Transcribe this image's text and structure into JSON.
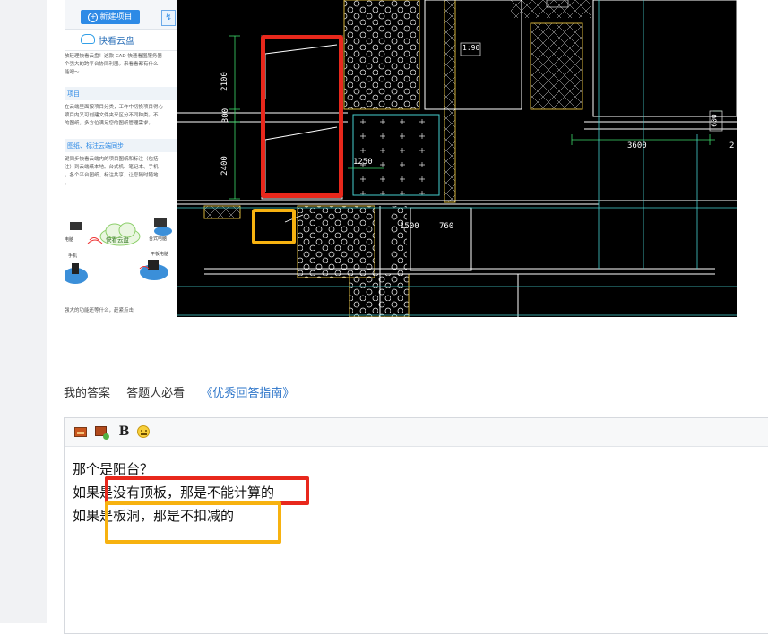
{
  "screenshot_panel": {
    "new_project_label": "新建项目",
    "cloud_title": "快看云盘",
    "intro_text": [
      "放轻理快看云盘！这款 CAD 快速看图服务器",
      "个强大的跨平台协同利器。来看看都有什么",
      "能吧～"
    ],
    "section1_title": "项目",
    "section1_text": [
      "在云端里面按项目分类，工作中切换项目得心",
      "项目内又可创建文件夹来区分不同种类。不",
      "的图纸，多方位满足您的图纸管理需求。"
    ],
    "section2_title": "图纸、标注云端同步",
    "section2_text": [
      "键同步快看云端内的项目图纸和标注（包括",
      "注）到云端纸本地。台式机、笔记本、手机",
      "，各个平台图纸、标注共享，让您随时随地",
      "。"
    ],
    "illus_labels": [
      "电脑",
      "快看云盘",
      "台式电脑",
      "手机",
      "平板电脑"
    ],
    "bottom_text": "强大的功能还等什么，赶紧点击"
  },
  "cad_labels": [
    "2100",
    "300",
    "2400",
    "1250",
    "1500",
    "760",
    "3600",
    "600",
    "2",
    "1:90"
  ],
  "colors": {
    "annotation_red": "#e8281c",
    "annotation_orange": "#f7b210",
    "link_blue": "#2b74c9"
  },
  "answer_tabs": {
    "my_answer": "我的答案",
    "must_read": "答题人必看",
    "guide_link": "《优秀回答指南》"
  },
  "toolbar": {
    "bold_label": "B",
    "icons": [
      "insert-image-icon",
      "upload-image-icon",
      "bold-icon",
      "emoji-icon"
    ]
  },
  "editor": {
    "lines": [
      "那个是阳台？",
      "如果是没有顶板，那是不能计算的",
      "如果是板洞，那是不扣减的"
    ]
  }
}
